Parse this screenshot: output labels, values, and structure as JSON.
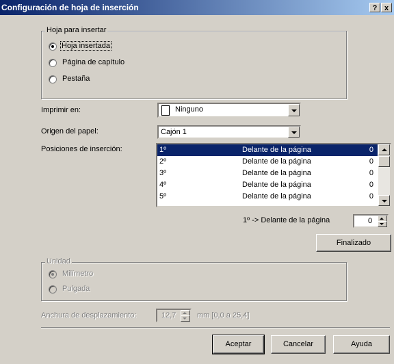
{
  "window": {
    "title": "Configuración de hoja de inserción",
    "help_btn": "?",
    "close_btn": "x"
  },
  "sheet_group": {
    "legend": "Hoja para insertar",
    "options": [
      "Hoja insertada",
      "Página de capítulo",
      "Pestaña"
    ],
    "selected": 0
  },
  "print_on": {
    "label": "Imprimir en:",
    "value": "Ninguno"
  },
  "paper_source": {
    "label": "Origen del papel:",
    "value": "Cajón 1"
  },
  "positions": {
    "label": "Posiciones de inserción:",
    "rows": [
      {
        "index": "1º",
        "position": "Delante de la página",
        "count": "0",
        "selected": true
      },
      {
        "index": "2º",
        "position": "Delante de la página",
        "count": "0",
        "selected": false
      },
      {
        "index": "3º",
        "position": "Delante de la página",
        "count": "0",
        "selected": false
      },
      {
        "index": "4º",
        "position": "Delante de la página",
        "count": "0",
        "selected": false
      },
      {
        "index": "5º",
        "position": "Delante de la página",
        "count": "0",
        "selected": false
      }
    ]
  },
  "current": {
    "label": "1º -> Delante de la página",
    "value": "0"
  },
  "finish_button": "Finalizado",
  "unit_group": {
    "legend": "Unidad",
    "options": [
      "Milímetro",
      "Pulgada"
    ],
    "selected": 0
  },
  "shift_width": {
    "label": "Anchura de desplazamiento:",
    "value": "12,7",
    "range": "mm [0,0 a 25,4]"
  },
  "footer": {
    "ok": "Aceptar",
    "cancel": "Cancelar",
    "help": "Ayuda"
  }
}
